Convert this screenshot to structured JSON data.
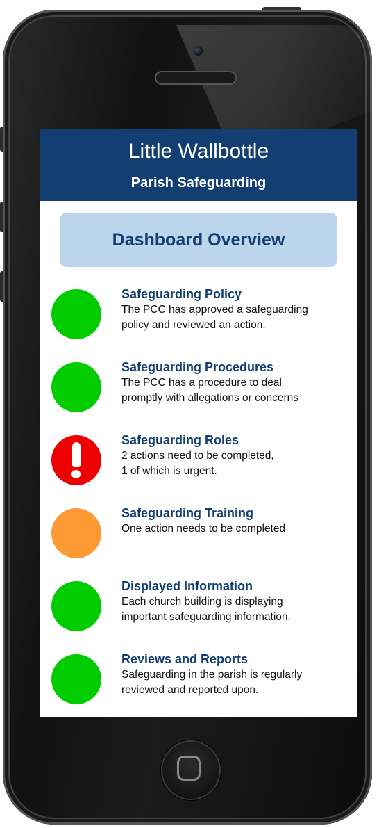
{
  "app": {
    "title": "Little Wallbottle",
    "subtitle": "Parish Safeguarding"
  },
  "dashboard_button": {
    "label": "Dashboard Overview"
  },
  "items": [
    {
      "title": "Safeguarding Policy",
      "desc_lines": [
        "The PCC has approved a safeguarding",
        "policy and reviewed an action."
      ],
      "status": "green"
    },
    {
      "title": "Safeguarding Procedures",
      "desc_lines": [
        "The PCC has a procedure to deal",
        "promptly with allegations or concerns"
      ],
      "status": "green"
    },
    {
      "title": "Safeguarding Roles",
      "desc_lines": [
        "2 actions need to be completed,",
        "1 of which is urgent."
      ],
      "status": "red"
    },
    {
      "title": "Safeguarding Training",
      "desc_lines": [
        "One action needs to be completed",
        ""
      ],
      "status": "orange"
    },
    {
      "title": "Displayed Information",
      "desc_lines": [
        "Each church building is displaying",
        "important safeguarding information."
      ],
      "status": "green"
    },
    {
      "title": "Reviews and Reports",
      "desc_lines": [
        "Safeguarding in the parish is regularly",
        "reviewed and reported upon."
      ],
      "status": "green"
    }
  ],
  "colors": {
    "header_bg": "#123e72",
    "dashboard_bg": "#bcd4ec",
    "status_green": "#00cc00",
    "status_orange": "#ff9933",
    "status_red": "#ee0000"
  },
  "icons": {
    "status_good": "green-status-circle-icon",
    "status_warning": "orange-status-circle-icon",
    "status_urgent": "exclamation-alert-icon",
    "home": "home-button-icon"
  }
}
